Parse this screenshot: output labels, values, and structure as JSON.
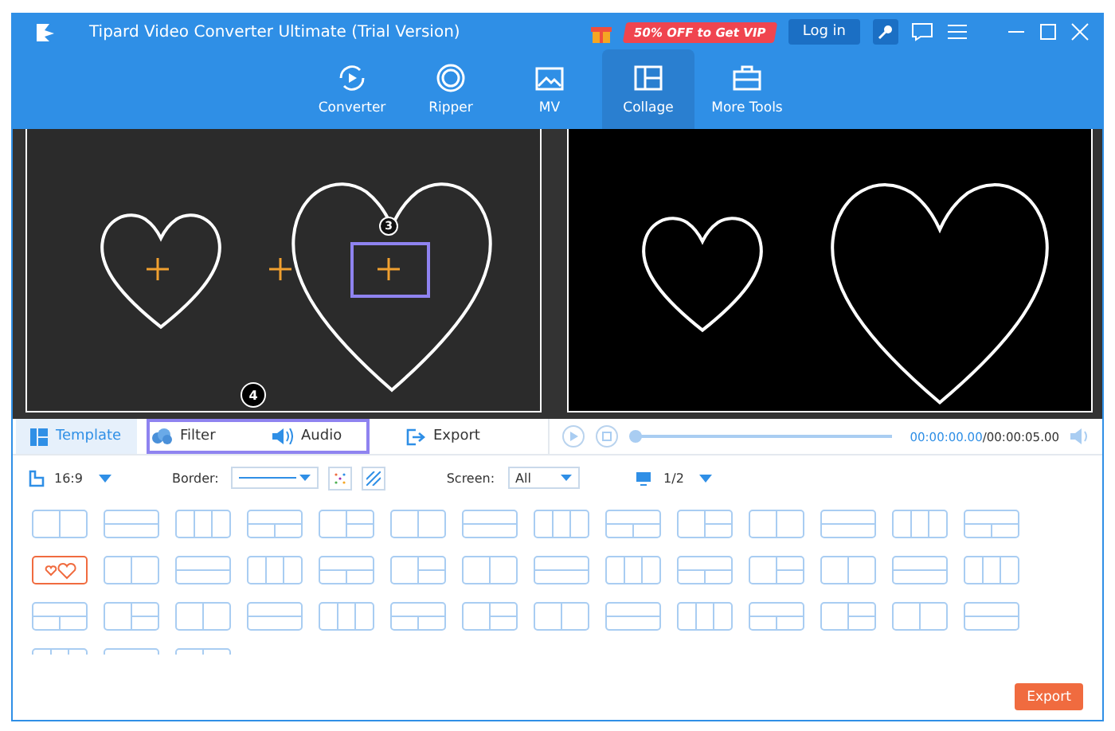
{
  "window": {
    "title": "Tipard Video Converter Ultimate (Trial Version)",
    "promo": "50% OFF to Get VIP",
    "login": "Log in"
  },
  "nav": [
    {
      "label": "Converter",
      "selected": false,
      "kind": "converter"
    },
    {
      "label": "Ripper",
      "selected": false,
      "kind": "ripper"
    },
    {
      "label": "MV",
      "selected": false,
      "kind": "mv"
    },
    {
      "label": "Collage",
      "selected": true,
      "kind": "collage"
    },
    {
      "label": "More Tools",
      "selected": false,
      "kind": "tools"
    }
  ],
  "annotations": [
    "3",
    "4"
  ],
  "tabs": [
    {
      "label": "Template",
      "selected": true,
      "kind": "template"
    },
    {
      "label": "Filter",
      "selected": false,
      "kind": "filter"
    },
    {
      "label": "Audio",
      "selected": false,
      "kind": "audio"
    },
    {
      "label": "Export",
      "selected": false,
      "kind": "export"
    }
  ],
  "player": {
    "level": 0,
    "current": "00:00:00.00",
    "total": "/00:00:05.00"
  },
  "toolbar": {
    "ratio": "16:9",
    "border_label": "Border:",
    "screen_label": "Screen:",
    "screen_value": "All",
    "page": "1/2"
  },
  "templates": [
    {
      "selected": false
    },
    {
      "selected": false
    },
    {
      "selected": false
    },
    {
      "selected": false
    },
    {
      "selected": false
    },
    {
      "selected": false
    },
    {
      "selected": false
    },
    {
      "selected": false
    },
    {
      "selected": false
    },
    {
      "selected": false
    },
    {
      "selected": false
    },
    {
      "selected": false
    },
    {
      "selected": false
    },
    {
      "selected": false
    },
    {
      "selected": true
    },
    {
      "selected": false
    },
    {
      "selected": false
    },
    {
      "selected": false
    },
    {
      "selected": false
    },
    {
      "selected": false
    },
    {
      "selected": false
    },
    {
      "selected": false
    },
    {
      "selected": false
    },
    {
      "selected": false
    },
    {
      "selected": false
    },
    {
      "selected": false
    },
    {
      "selected": false
    },
    {
      "selected": false
    },
    {
      "selected": false
    },
    {
      "selected": false
    },
    {
      "selected": false
    },
    {
      "selected": false
    },
    {
      "selected": false
    },
    {
      "selected": false
    },
    {
      "selected": false
    },
    {
      "selected": false
    },
    {
      "selected": false
    },
    {
      "selected": false
    },
    {
      "selected": false
    },
    {
      "selected": false
    },
    {
      "selected": false
    },
    {
      "selected": false
    },
    {
      "selected": false
    },
    {
      "selected": false
    },
    {
      "selected": false
    }
  ],
  "export_button": "Export"
}
